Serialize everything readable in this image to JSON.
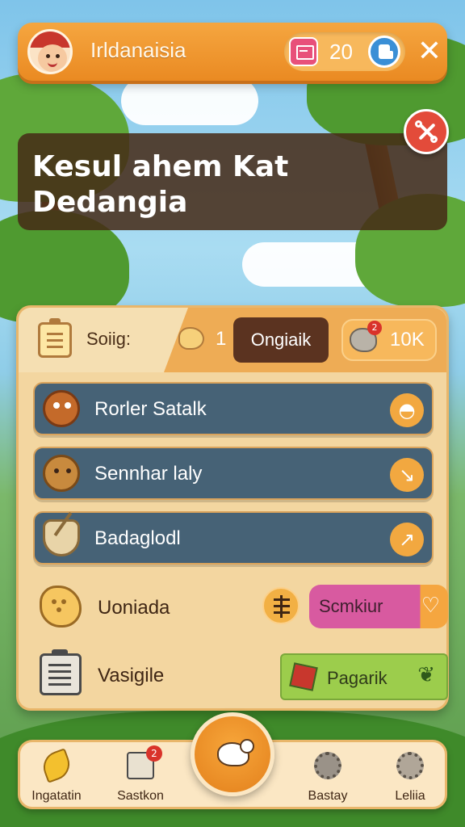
{
  "header": {
    "title": "Irldanaisia",
    "coins": "20",
    "close_label": "✕"
  },
  "banner": {
    "title": "Kesul ahem Kat Dedangia"
  },
  "panel": {
    "score_label": "Soiig:",
    "cookie_count": "1",
    "ongiaik_label": "Ongiaik",
    "gem_badge": "2",
    "gem_count": "10K",
    "rows": [
      {
        "label": "Rorler Satalk",
        "icon": "monster-icon",
        "action_icon": "hat-icon"
      },
      {
        "label": "Sennhar laly",
        "icon": "bear-icon",
        "action_icon": "arrow-down-right-icon"
      },
      {
        "label": "Badaglodl",
        "icon": "bowl-icon",
        "action_icon": "arrow-up-right-icon"
      }
    ],
    "lower": {
      "uoniada_label": "Uoniada",
      "scmkiur_label": "Scmkiur",
      "vasigile_label": "Vasigile",
      "pagarik_label": "Pagarik"
    }
  },
  "nav": {
    "items": [
      {
        "label": "Ingatatin",
        "icon": "banana-icon"
      },
      {
        "label": "Sastkon",
        "icon": "message-icon",
        "badge": "2"
      },
      {
        "label": "Bastay",
        "icon": "gear-icon"
      },
      {
        "label": "Leliia",
        "icon": "gear-icon"
      }
    ]
  },
  "colors": {
    "accent": "#ea8a22",
    "row_bg": "#466276",
    "panel_bg": "#f3d6a0",
    "banner_bg": "#462a16"
  }
}
